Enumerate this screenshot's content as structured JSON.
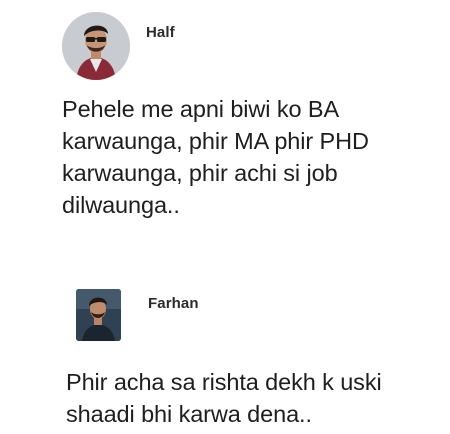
{
  "posts": [
    {
      "author": "Half",
      "avatar_icon": "user-avatar-icon",
      "text": "Pehele me apni biwi ko BA\nkarwaunga, phir MA phir PHD\nkarwaunga, phir achi si job\ndilwaunga.."
    },
    {
      "author": "Farhan",
      "avatar_icon": "user-avatar-icon",
      "text": "Phir acha sa rishta dekh k uski\nshaadi bhi karwa dena.."
    }
  ],
  "colors": {
    "background": "#ffffff",
    "text": "#1e1e1e",
    "name": "#2b2b2b"
  }
}
